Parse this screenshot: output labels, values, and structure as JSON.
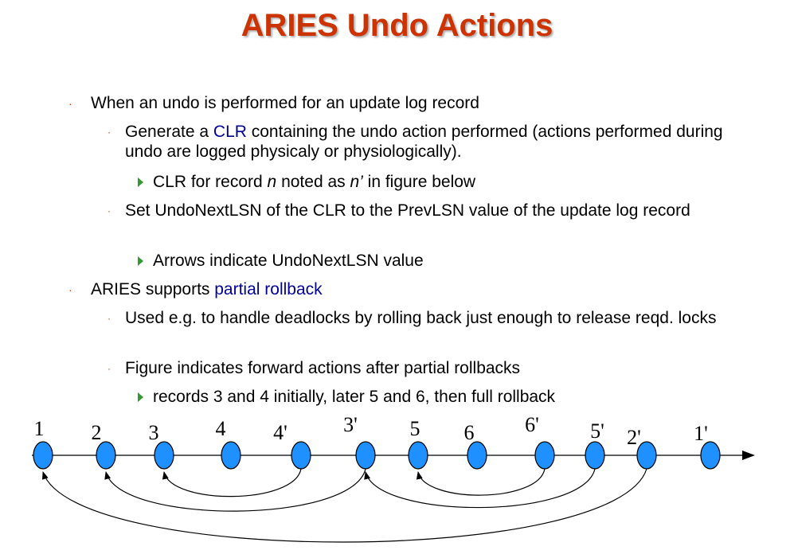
{
  "title": "ARIES Undo Actions",
  "bullets": {
    "b1": {
      "text": "When an undo is performed for an update log record",
      "sub1": {
        "pre": "Generate a ",
        "hl": "CLR",
        "post": " containing the undo action performed (actions performed during undo are logged physicaly or physiologically).",
        "sub": {
          "a": "CLR for   record ",
          "b": "n",
          "c": " noted as ",
          "d": "n’",
          "e": " in figure below"
        }
      },
      "sub2": {
        "text": "Set UndoNextLSN of the CLR to the PrevLSN value of the update log record",
        "sub": "Arrows indicate UndoNextLSN value"
      }
    },
    "b2": {
      "pre": "ARIES supports ",
      "hl": "partial rollback",
      "sub1": {
        "text": "Used e.g. to handle deadlocks by rolling back just enough to release reqd. locks"
      },
      "sub2": {
        "text": "Figure indicates forward actions after partial rollbacks",
        "sub": "records 3 and 4 initially, later 5 and 6, then full rollback"
      }
    }
  },
  "diagram": {
    "node_color": "#1e90ff",
    "nodes": [
      {
        "label": "1"
      },
      {
        "label": "2"
      },
      {
        "label": "3"
      },
      {
        "label": "4"
      },
      {
        "label": "4'"
      },
      {
        "label": "3'"
      },
      {
        "label": "5"
      },
      {
        "label": "6"
      },
      {
        "label": "6'"
      },
      {
        "label": "5'"
      },
      {
        "label": "2'"
      },
      {
        "label": "1'"
      }
    ],
    "arrows": [
      {
        "from": 4,
        "to": 2
      },
      {
        "from": 5,
        "to": 1
      },
      {
        "from": 8,
        "to": 6
      },
      {
        "from": 9,
        "to": 5
      },
      {
        "from": 10,
        "to": 0
      }
    ]
  }
}
